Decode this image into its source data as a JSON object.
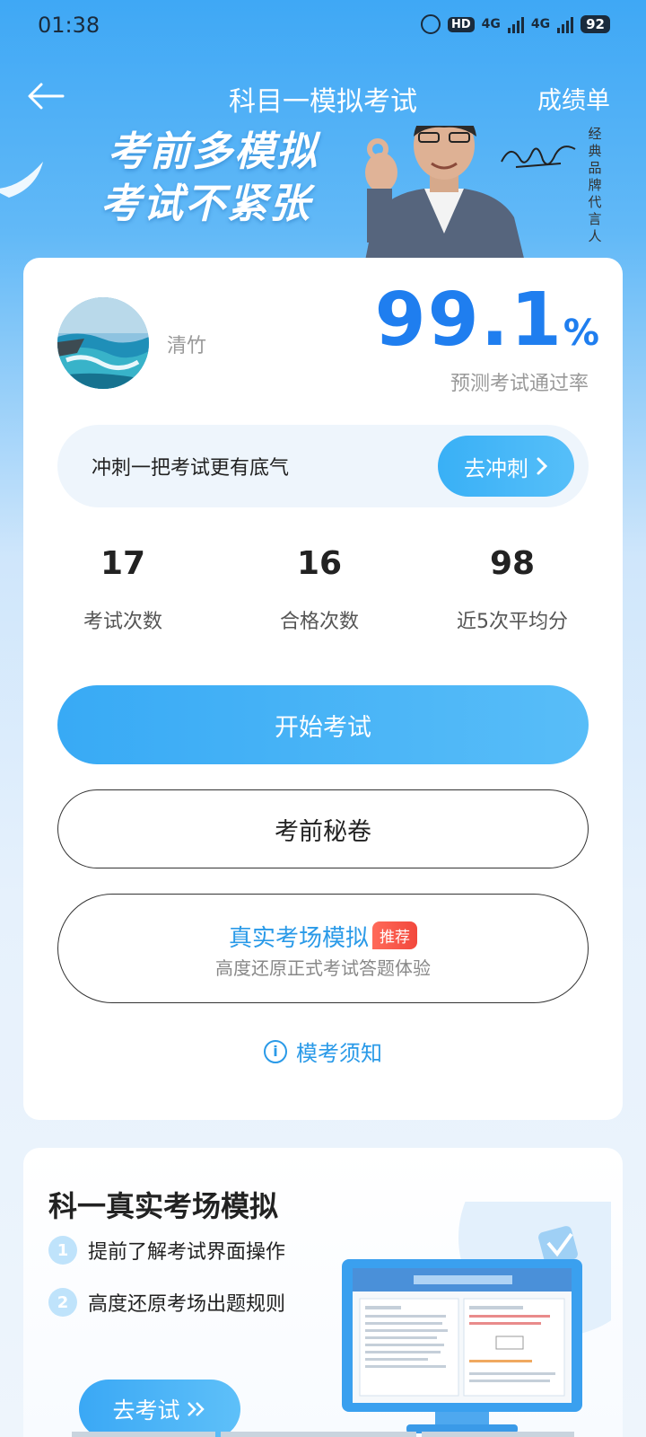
{
  "status_bar": {
    "time": "01:38",
    "hd_label": "HD",
    "signal1_label": "4G",
    "signal2_label": "4G",
    "battery": "92"
  },
  "header": {
    "title": "科目一模拟考试",
    "report_label": "成绩单"
  },
  "banner": {
    "slogan_line1": "考前多模拟",
    "slogan_line2": "考试不紧张",
    "endorsement": "经典品牌代言人"
  },
  "user": {
    "name": "清竹",
    "pass_rate_value": "99.1",
    "pass_rate_unit": "%",
    "pass_rate_label": "预测考试通过率"
  },
  "sprint": {
    "text": "冲刺一把考试更有底气",
    "button_label": "去冲刺"
  },
  "stats": [
    {
      "value": "17",
      "label": "考试次数"
    },
    {
      "value": "16",
      "label": "合格次数"
    },
    {
      "value": "98",
      "label": "近5次平均分"
    }
  ],
  "actions": {
    "start_label": "开始考试",
    "secret_label": "考前秘卷",
    "real_title": "真实考场模拟",
    "real_tag": "推荐",
    "real_subtitle": "高度还原正式考试答题体验",
    "notice_label": "模考须知"
  },
  "bottom": {
    "title": "科一真实考场模拟",
    "features": [
      {
        "index": "1",
        "text": "提前了解考试界面操作"
      },
      {
        "index": "2",
        "text": "高度还原考场出题规则"
      }
    ],
    "go_label": "去考试"
  },
  "colors": {
    "accent_blue": "#1f7eef",
    "button_blue": "#3aacf6",
    "tag_red": "#f2483c"
  }
}
